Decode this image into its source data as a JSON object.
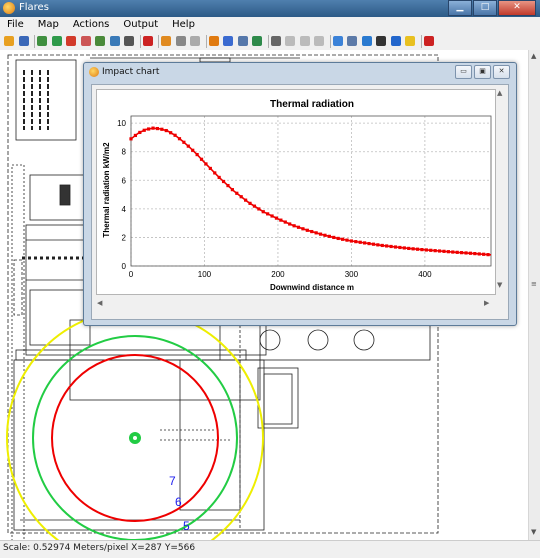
{
  "window": {
    "title": "Flares",
    "buttons": [
      "▁",
      "□",
      "✕"
    ]
  },
  "menu": [
    "File",
    "Map",
    "Actions",
    "Output",
    "Help"
  ],
  "toolbar": {
    "icons": [
      "open-icon",
      "save-icon",
      "map-icon",
      "tree-icon",
      "pin-icon",
      "pen-icon",
      "layers-icon",
      "grid-icon",
      "print-icon",
      "cut-icon",
      "chart-icon",
      "bar-icon",
      "column-icon",
      "flame-icon",
      "table-icon",
      "stats-icon",
      "report-icon",
      "headset-icon",
      "blank-icon",
      "blank-icon",
      "blank-icon",
      "form-icon",
      "mail-icon",
      "globe-icon",
      "binoculars-icon",
      "help-icon",
      "bulb-icon",
      "exit-icon"
    ],
    "colors": [
      "#e8a020",
      "#3b68b8",
      "#3f8f3f",
      "#2e9a4a",
      "#d23a2a",
      "#cc5555",
      "#4a8a3a",
      "#3a7ab8",
      "#555555",
      "#cc2222",
      "#e08a20",
      "#888888",
      "#aaaaaa",
      "#e07a10",
      "#3a6ad0",
      "#5577aa",
      "#2e8a4a",
      "#666666",
      "#bbbbbb",
      "#bbbbbb",
      "#bbbbbb",
      "#3b82d8",
      "#5c7aa8",
      "#2a7ad0",
      "#333333",
      "#2266cc",
      "#e8c020",
      "#cc2222"
    ]
  },
  "popup": {
    "title": "Impact chart",
    "buttons": [
      "▭",
      "▣",
      "✕"
    ]
  },
  "chart_data": {
    "type": "line",
    "title": "Thermal radiation",
    "xlabel": "Downwind distance m",
    "ylabel": "Thermal radiation kW/m2",
    "xlim": [
      0,
      490
    ],
    "ylim": [
      0,
      10.5
    ],
    "xticks": [
      0,
      100,
      200,
      300,
      400
    ],
    "yticks": [
      0,
      2,
      4,
      6,
      8,
      10
    ],
    "grid": true,
    "series": [
      {
        "color": "#ee0000",
        "x": [
          0,
          10,
          20,
          30,
          40,
          50,
          60,
          70,
          80,
          90,
          100,
          120,
          140,
          160,
          180,
          200,
          220,
          240,
          260,
          280,
          300,
          320,
          340,
          360,
          380,
          400,
          420,
          440,
          460,
          480,
          490
        ],
        "y": [
          8.9,
          9.3,
          9.55,
          9.65,
          9.6,
          9.45,
          9.15,
          8.75,
          8.3,
          7.8,
          7.25,
          6.2,
          5.25,
          4.45,
          3.8,
          3.3,
          2.85,
          2.5,
          2.2,
          1.95,
          1.75,
          1.6,
          1.45,
          1.33,
          1.22,
          1.13,
          1.05,
          0.97,
          0.9,
          0.82,
          0.78
        ]
      }
    ]
  },
  "map": {
    "circles": [
      {
        "label": "7",
        "color": "#ee0000"
      },
      {
        "label": "6",
        "color": "#22cc44"
      },
      {
        "label": "5",
        "color": "#eeee00"
      }
    ],
    "label_color": "#1a1aee"
  },
  "status": "Scale: 0.52974 Meters/pixel  X=287 Y=566"
}
